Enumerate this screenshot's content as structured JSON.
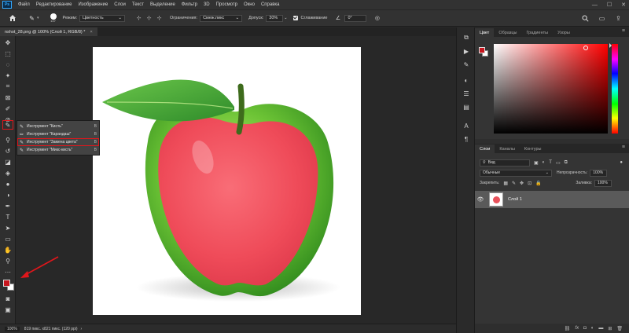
{
  "menu": {
    "logo": "Ps",
    "items": [
      "Файл",
      "Редактирование",
      "Изображение",
      "Слои",
      "Текст",
      "Выделение",
      "Фильтр",
      "3D",
      "Просмотр",
      "Окно",
      "Справка"
    ]
  },
  "window": {
    "minimize": "—",
    "maximize": "☐",
    "close": "✕"
  },
  "options": {
    "brush_size": "147",
    "mode_label": "Режим:",
    "mode_value": "Цветность",
    "limits_label": "Ограничения:",
    "limits_value": "Смеж.пикс",
    "tolerance_label": "Допуск:",
    "tolerance_value": "30%",
    "antialias_label": "Сглаживание",
    "angle_value": "0°"
  },
  "document": {
    "tab_title": "nshot_28.png @ 100% (Слой 1, RGB/8) *",
    "tab_close": "×"
  },
  "tool_flyout": {
    "items": [
      {
        "label": "Инструмент \"Кисть\"",
        "key": "B"
      },
      {
        "label": "Инструмент \"Карандаш\"",
        "key": "B"
      },
      {
        "label": "Инструмент \"Замена цвета\"",
        "key": "B"
      },
      {
        "label": "Инструмент \"Микс-кисть\"",
        "key": "B"
      }
    ]
  },
  "status": {
    "zoom": "100%",
    "info": "819 пикс. x821 пикс. (120 ppi)"
  },
  "color_panel": {
    "tabs": [
      "Цвет",
      "Образцы",
      "Градиенты",
      "Узоры"
    ],
    "foreground": "#c8161e",
    "background": "#ffffff"
  },
  "layers_panel": {
    "tabs": [
      "Слои",
      "Каналы",
      "Контуры"
    ],
    "filter_value": "Вид",
    "blend_mode": "Обычные",
    "opacity_label": "Непрозрачность:",
    "opacity_value": "100%",
    "lock_label": "Закрепить:",
    "fill_label": "Заливка:",
    "fill_value": "100%",
    "layer_name": "Слой 1"
  }
}
